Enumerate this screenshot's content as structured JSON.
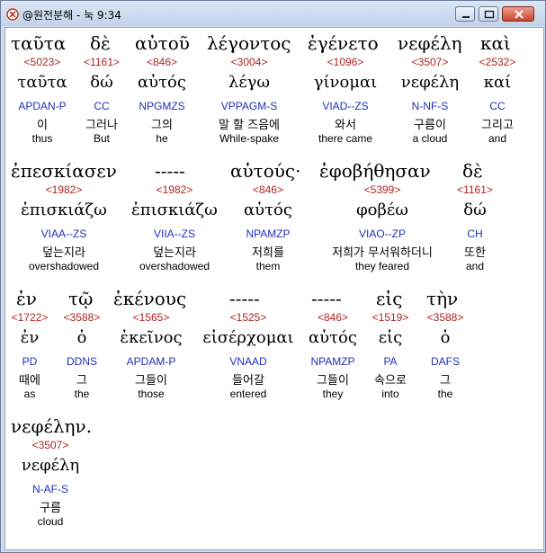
{
  "window": {
    "title": "@원전분해 - 눅 9:34"
  },
  "buttons": {
    "minimize": "minimize",
    "maximize": "maximize",
    "close": "close"
  },
  "rows": [
    {
      "words": [
        {
          "greek": "ταῦτα",
          "strong": "<5023>",
          "lemma": "ταῦτα",
          "morph": "APDAN-P",
          "korean": "이",
          "english": "thus"
        },
        {
          "greek": "δὲ",
          "strong": "<1161>",
          "lemma": "δώ",
          "morph": "CC",
          "korean": "그러나",
          "english": "But"
        },
        {
          "greek": "αὐτοῦ",
          "strong": "<846>",
          "lemma": "αὐτός",
          "morph": "NPGMZS",
          "korean": "그의",
          "english": "he"
        },
        {
          "greek": "λέγοντος",
          "strong": "<3004>",
          "lemma": "λέγω",
          "morph": "VPPAGM-S",
          "korean": "말 할 즈음에",
          "english": "While-spake"
        },
        {
          "greek": "ἐγένετο",
          "strong": "<1096>",
          "lemma": "γίνομαι",
          "morph": "VIAD--ZS",
          "korean": "와서",
          "english": "there came"
        },
        {
          "greek": "νεφέλη",
          "strong": "<3507>",
          "lemma": "νεφέλη",
          "morph": "N-NF-S",
          "korean": "구름이",
          "english": "a cloud"
        },
        {
          "greek": "καὶ",
          "strong": "<2532>",
          "lemma": "καί",
          "morph": "CC",
          "korean": "그리고",
          "english": "and"
        }
      ]
    },
    {
      "words": [
        {
          "greek": "ἐπεσκίασεν",
          "strong": "<1982>",
          "lemma": "ἐπισκιάζω",
          "morph": "VIAA--ZS",
          "korean": "덮는지라",
          "english": "overshadowed"
        },
        {
          "greek": "-----",
          "strong": "<1982>",
          "lemma": "ἐπισκιάζω",
          "morph": "VIIA--ZS",
          "korean": "덮는지라",
          "english": "overshadowed"
        },
        {
          "greek": "αὐτούς·",
          "strong": "<846>",
          "lemma": "αὐτός",
          "morph": "NPAMZP",
          "korean": "저희를",
          "english": "them"
        },
        {
          "greek": "ἐφοβήθησαν",
          "strong": "<5399>",
          "lemma": "φοβέω",
          "morph": "VIAO--ZP",
          "korean": "저희가 무서워하더니",
          "english": "they feared"
        },
        {
          "greek": "δὲ",
          "strong": "<1161>",
          "lemma": "δώ",
          "morph": "CH",
          "korean": "또한",
          "english": "and"
        }
      ]
    },
    {
      "words": [
        {
          "greek": "ἐν",
          "strong": "<1722>",
          "lemma": "ἐν",
          "morph": "PD",
          "korean": "때에",
          "english": "as"
        },
        {
          "greek": "τῷ",
          "strong": "<3588>",
          "lemma": "ὁ",
          "morph": "DDNS",
          "korean": "그",
          "english": "the"
        },
        {
          "greek": "ἐκένους",
          "strong": "<1565>",
          "lemma": "ἐκεῖνος",
          "morph": "APDAM-P",
          "korean": "그들이",
          "english": "those"
        },
        {
          "greek": "-----",
          "strong": "<1525>",
          "lemma": "εἰσέρχομαι",
          "morph": "VNAAD",
          "korean": "들어갈",
          "english": "entered"
        },
        {
          "greek": "-----",
          "strong": "<846>",
          "lemma": "αὐτός",
          "morph": "NPAMZP",
          "korean": "그들이",
          "english": "they"
        },
        {
          "greek": "εἰς",
          "strong": "<1519>",
          "lemma": "εἰς",
          "morph": "PA",
          "korean": "속으로",
          "english": "into"
        },
        {
          "greek": "τὴν",
          "strong": "<3588>",
          "lemma": "ὁ",
          "morph": "DAFS",
          "korean": "그",
          "english": "the"
        }
      ]
    },
    {
      "words": [
        {
          "greek": "νεφέλην.",
          "strong": "<3507>",
          "lemma": "νεφέλη",
          "morph": "N-AF-S",
          "korean": "구름",
          "english": "cloud"
        }
      ]
    }
  ]
}
